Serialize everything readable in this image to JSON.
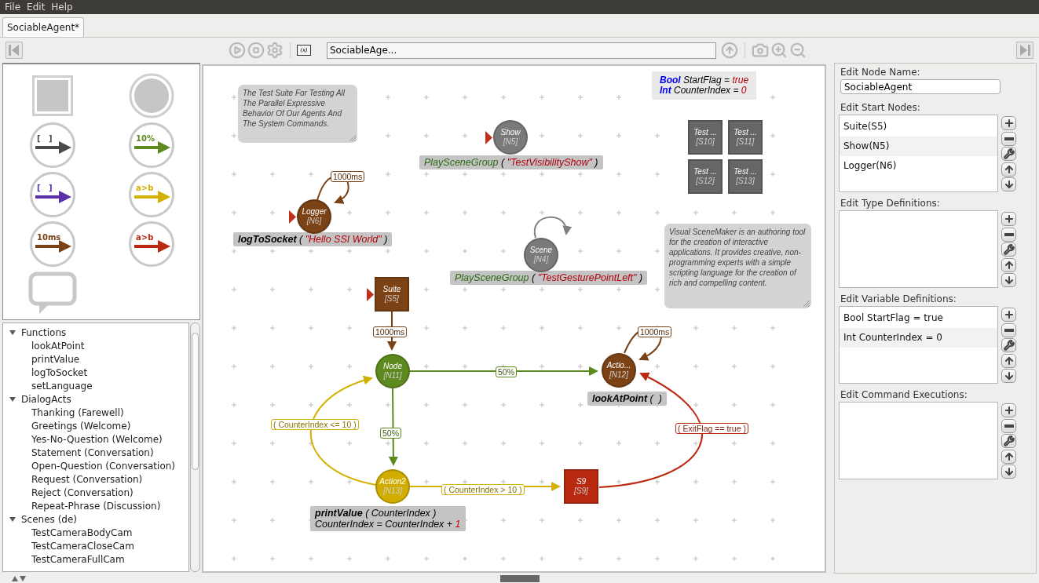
{
  "menu": [
    {
      "label": "File"
    },
    {
      "label": "Edit"
    },
    {
      "label": "Help"
    }
  ],
  "tabs": [
    {
      "label": "SociableAgent*",
      "selected": true
    }
  ],
  "toolbar": {
    "variables_button": "(x)",
    "scene_field": "SociableAge..."
  },
  "palette": [
    {
      "kind": "supernode"
    },
    {
      "kind": "node"
    },
    {
      "kind": "edge",
      "label": "[   ]",
      "color": "#4a4a4a"
    },
    {
      "kind": "edge",
      "label": "10%",
      "color": "#5d8a1f"
    },
    {
      "kind": "edge",
      "label": "[   ]",
      "color": "#5a2fa8"
    },
    {
      "kind": "edge",
      "label": "a>b",
      "color": "#d4b000"
    },
    {
      "kind": "edge",
      "label": "10ms",
      "color": "#7b4216"
    },
    {
      "kind": "edge",
      "label": "a>b",
      "color": "#bb2a10"
    },
    {
      "kind": "comment"
    }
  ],
  "tree": [
    {
      "label": "Functions",
      "expanded": true,
      "children": [
        {
          "label": "lookAtPoint"
        },
        {
          "label": "printValue"
        },
        {
          "label": "logToSocket"
        },
        {
          "label": "setLanguage"
        }
      ]
    },
    {
      "label": "DialogActs",
      "expanded": true,
      "children": [
        {
          "label": "Thanking (Farewell)"
        },
        {
          "label": "Greetings (Welcome)"
        },
        {
          "label": "Yes-No-Question (Welcome)"
        },
        {
          "label": "Statement (Conversation)"
        },
        {
          "label": "Open-Question (Conversation)"
        },
        {
          "label": "Request (Conversation)"
        },
        {
          "label": "Reject (Conversation)"
        },
        {
          "label": "Repeat-Phrase (Discussion)"
        }
      ]
    },
    {
      "label": "Scenes (de)",
      "expanded": true,
      "children": [
        {
          "label": "TestCameraBodyCam"
        },
        {
          "label": "TestCameraCloseCam"
        },
        {
          "label": "TestCameraFullCam"
        }
      ]
    }
  ],
  "canvas": {
    "comments": [
      {
        "text": "The Test Suite For Testing All The Parallel Expressive Behavior Of Our Agents And The System Commands."
      },
      {
        "text": "Visual SceneMaker is an authoring tool for the  creation of interactive applications.  It provides creative, non-programming experts with a simple scripting language for the creation of rich and compelling content."
      }
    ],
    "variables": [
      [
        {
          "text": "Bool",
          "kind": "type"
        },
        {
          "text": " StartFlag = ",
          "kind": "plain"
        },
        {
          "text": "true",
          "kind": "value"
        }
      ],
      [
        {
          "text": "Int",
          "kind": "type"
        },
        {
          "text": " CounterIndex = ",
          "kind": "plain"
        },
        {
          "text": "0",
          "kind": "value"
        }
      ]
    ],
    "nodes": [
      {
        "kind": "node",
        "name": "Show",
        "tag": "[N5]",
        "color": "#7a7a7a",
        "start": true
      },
      {
        "kind": "node",
        "name": "Logger",
        "tag": "[N6]",
        "color": "#7b4216",
        "start": true
      },
      {
        "kind": "node",
        "name": "Scene",
        "tag": "[N4]",
        "color": "#7a7a7a",
        "start": false
      },
      {
        "kind": "supernode",
        "name": "Suite",
        "tag": "[S5]",
        "color": "#7b4216",
        "start": true
      },
      {
        "kind": "node",
        "name": "Node",
        "tag": "[N11]",
        "color": "#5d8a1f",
        "start": false
      },
      {
        "kind": "node",
        "name": "Actio...",
        "tag": "[N12]",
        "color": "#7b4216",
        "start": false
      },
      {
        "kind": "node",
        "name": "Action2",
        "tag": "[N13]",
        "color": "#d1ad00",
        "start": false
      },
      {
        "kind": "supernode",
        "name": "S9",
        "tag": "[S9]",
        "color": "#b8290f",
        "start": false
      },
      {
        "kind": "supernode",
        "name": "Test ...",
        "tag": "[S10]",
        "color": "#666666",
        "start": false
      },
      {
        "kind": "supernode",
        "name": "Test ...",
        "tag": "[S11]",
        "color": "#666666",
        "start": false
      },
      {
        "kind": "supernode",
        "name": "Test ...",
        "tag": "[S12]",
        "color": "#666666",
        "start": false
      },
      {
        "kind": "supernode",
        "name": "Test ...",
        "tag": "[S13]",
        "color": "#666666",
        "start": false
      }
    ],
    "commands": [
      {
        "lines": [
          [
            {
              "text": "PlaySceneGroup",
              "kind": "scene"
            },
            {
              "text": " ( ",
              "kind": "plain"
            },
            {
              "text": "\"TestVisibilityShow\"",
              "kind": "string"
            },
            {
              "text": " )",
              "kind": "plain"
            }
          ]
        ]
      },
      {
        "lines": [
          [
            {
              "text": "logToSocket",
              "kind": "function"
            },
            {
              "text": " ( ",
              "kind": "plain"
            },
            {
              "text": "\"Hello SSI World\"",
              "kind": "string"
            },
            {
              "text": " )",
              "kind": "plain"
            }
          ]
        ]
      },
      {
        "lines": [
          [
            {
              "text": "PlaySceneGroup",
              "kind": "scene"
            },
            {
              "text": " ( ",
              "kind": "plain"
            },
            {
              "text": "\"TestGesturePointLeft\"",
              "kind": "string"
            },
            {
              "text": " )",
              "kind": "plain"
            }
          ]
        ]
      },
      {
        "lines": [
          [
            {
              "text": "lookAtPoint",
              "kind": "function"
            },
            {
              "text": " (  )",
              "kind": "plain"
            }
          ]
        ]
      },
      {
        "lines": [
          [
            {
              "text": "printValue",
              "kind": "function"
            },
            {
              "text": " ( CounterIndex )",
              "kind": "plain"
            }
          ],
          [
            {
              "text": "CounterIndex = CounterIndex + ",
              "kind": "plain"
            },
            {
              "text": "1",
              "kind": "number"
            }
          ]
        ]
      }
    ],
    "edges": [
      {
        "label": "1000ms",
        "color": "#7b4216"
      },
      {
        "color": "#808080"
      },
      {
        "label": "1000ms",
        "color": "#7b4216"
      },
      {
        "label": "1000ms",
        "color": "#7b4216"
      },
      {
        "label": "50%",
        "color": "#5d8a1f"
      },
      {
        "label": "50%",
        "color": "#5d8a1f"
      },
      {
        "label": "( CounterIndex <= 10 )",
        "color": "#d4b000"
      },
      {
        "label": "( CounterIndex > 10 )",
        "color": "#d4b000"
      },
      {
        "label": "( ExitFlag == true )",
        "color": "#bb2a10"
      }
    ]
  },
  "inspector": {
    "node_name": {
      "label": "Edit Node Name:",
      "value": "SociableAgent"
    },
    "lists": [
      {
        "label": "Edit Start Nodes:",
        "items": [
          {
            "text": "Suite(S5)"
          },
          {
            "text": "Show(N5)"
          },
          {
            "text": "Logger(N6)"
          }
        ]
      },
      {
        "label": "Edit Type Definitions:"
      },
      {
        "label": "Edit Variable Definitions:",
        "items": [
          {
            "text": "Bool StartFlag = true"
          },
          {
            "text": "Int CounterIndex = 0"
          }
        ]
      },
      {
        "label": "Edit Command Executions:"
      }
    ]
  }
}
